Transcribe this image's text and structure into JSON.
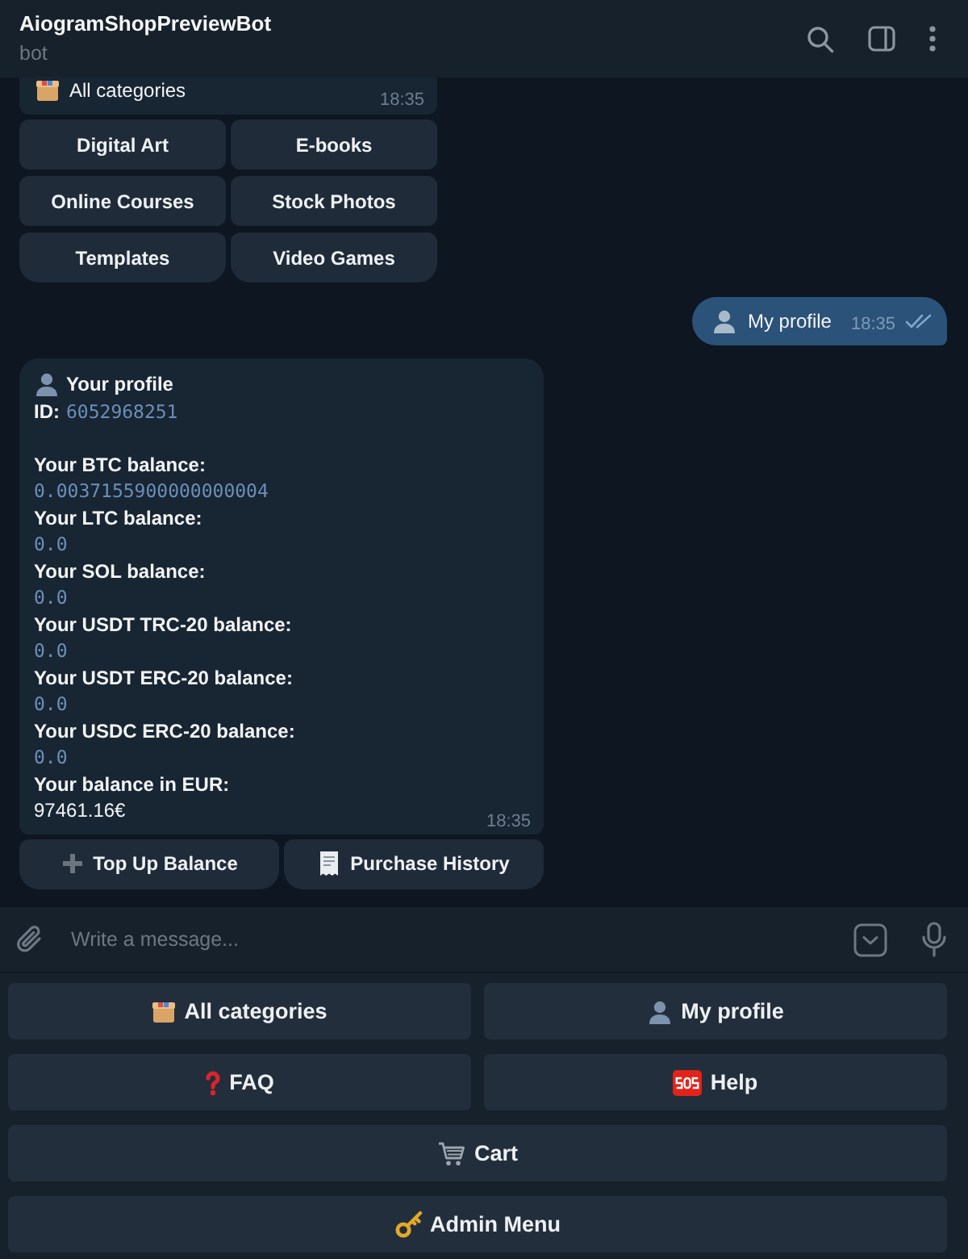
{
  "header": {
    "title": "AiogramShopPreviewBot",
    "subtitle": "bot"
  },
  "messages": [
    {
      "kind": "incoming",
      "text": "All categories",
      "time": "18:35",
      "buttons": [
        [
          "Digital Art",
          "E-books"
        ],
        [
          "Online Courses",
          "Stock Photos"
        ],
        [
          "Templates",
          "Video Games"
        ]
      ]
    },
    {
      "kind": "outgoing",
      "text": "My profile",
      "time": "18:35",
      "read": true
    },
    {
      "kind": "profile",
      "title": "Your profile",
      "id_label": "ID:",
      "id": "6052968251",
      "balances": [
        {
          "label": "Your BTC balance:",
          "value": "0.0037155900000000004",
          "kind": "code"
        },
        {
          "label": "Your LTC balance:",
          "value": "0.0",
          "kind": "code"
        },
        {
          "label": "Your SOL balance:",
          "value": "0.0",
          "kind": "code"
        },
        {
          "label": "Your USDT TRC-20 balance:",
          "value": "0.0",
          "kind": "code"
        },
        {
          "label": "Your USDT ERC-20 balance:",
          "value": "0.0",
          "kind": "code"
        },
        {
          "label": "Your USDC ERC-20 balance:",
          "value": "0.0",
          "kind": "code"
        },
        {
          "label": "Your balance in EUR:",
          "value": "97461.16€",
          "kind": "plain"
        }
      ],
      "time": "18:35",
      "buttons": [
        [
          "Top Up Balance",
          "Purchase History"
        ]
      ]
    }
  ],
  "composer": {
    "placeholder": "Write a message..."
  },
  "keyboard": [
    [
      "All categories",
      "My profile"
    ],
    [
      "FAQ",
      "Help"
    ],
    [
      "Cart"
    ],
    [
      "Admin Menu"
    ]
  ]
}
